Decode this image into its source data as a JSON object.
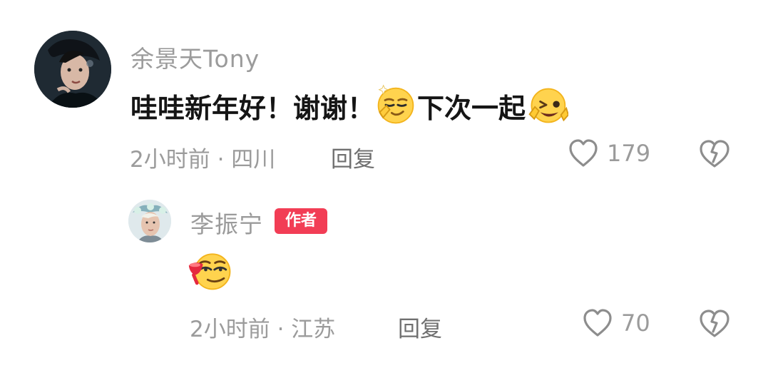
{
  "comments": {
    "main": {
      "username": "余景天Tony",
      "text_parts": [
        "哇哇新年好！谢谢！",
        "下次一起"
      ],
      "time_location": "2小时前 · 四川",
      "reply_label": "回复",
      "likes": "179",
      "avatar_icon": "profile-avatar-icon",
      "emoji_icons": [
        "smug-face-icon",
        "winking-face-icon"
      ]
    },
    "reply": {
      "username": "李振宁",
      "badge": "作者",
      "time_location": "2小时前 · 江苏",
      "reply_label": "回复",
      "likes": "70",
      "avatar_icon": "profile-avatar-icon",
      "emoji_icon": "drink-face-icon"
    }
  },
  "colors": {
    "text_gray": "#9b9b9b",
    "text_dark": "#151515",
    "badge_red": "#f23d55"
  }
}
